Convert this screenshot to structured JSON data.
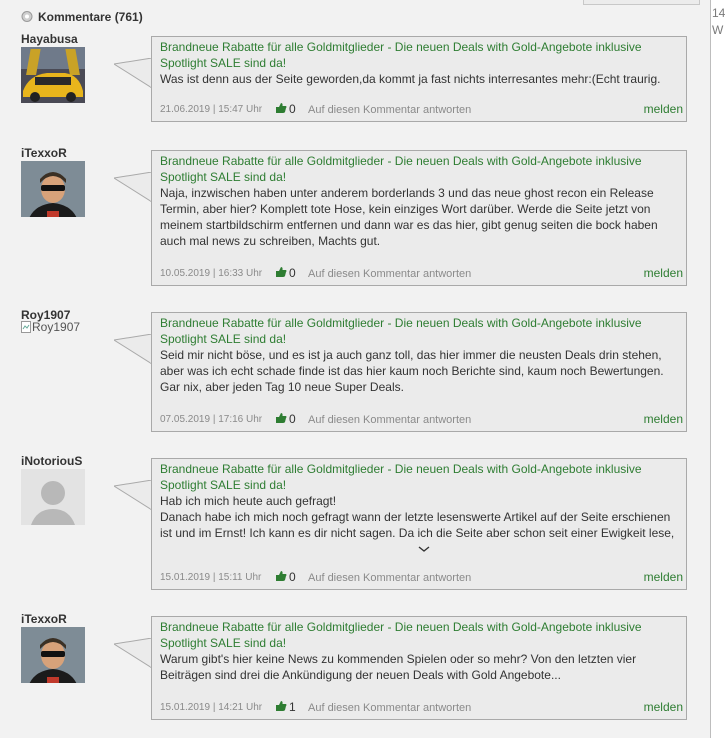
{
  "header": {
    "label": "Kommentare (761)"
  },
  "side_text": [
    "14",
    "W"
  ],
  "article_title": "Brandneue Rabatte für alle Goldmitglieder - Die neuen Deals with Gold-Angebote inklusive Spotlight SALE sind da!",
  "reply_label": "Auf diesen Kommentar antworten",
  "report_label": "melden",
  "comments": [
    {
      "author": "Hayabusa",
      "text": "Was ist denn aus der Seite geworden,da kommt ja fast nichts interresantes mehr:(Echt traurig.",
      "date": "21.06.2019 | 15:47 Uhr",
      "likes": "0"
    },
    {
      "author": "iTexxoR",
      "text": "Naja, inzwischen haben unter anderem borderlands 3 und das neue ghost recon ein Release Termin, aber hier? Komplett tote Hose, kein einziges Wort darüber. Werde die Seite jetzt von meinem startbildschirm entfernen und dann war es das hier, gibt genug seiten die bock haben auch mal news zu schreiben, Machts gut.",
      "date": "10.05.2019 | 16:33 Uhr",
      "likes": "0"
    },
    {
      "author": "Roy1907",
      "avatar_alt": "Roy1907",
      "text": "Seid mir nicht böse, und es ist ja auch ganz toll, das hier immer die neusten Deals drin stehen, aber was ich echt schade finde ist das hier kaum noch Berichte sind, kaum noch Bewertungen. Gar nix, aber jeden Tag 10 neue Super Deals.",
      "date": "07.05.2019 | 17:16 Uhr",
      "likes": "0"
    },
    {
      "author": "iNotoriouS",
      "text": "Hab ich mich heute auch gefragt!\nDanach habe ich mich noch gefragt wann der letzte lesenswerte Artikel auf der Seite erschienen ist und im Ernst! Ich kann es dir nicht sagen. Da ich die Seite aber schon seit einer Ewigkeit lese,",
      "date": "15.01.2019 | 15:11 Uhr",
      "likes": "0"
    },
    {
      "author": "iTexxoR",
      "text": "Warum gibt's hier keine News zu kommenden Spielen oder so mehr? Von den letzten vier Beiträgen sind drei die Ankündigung der neuen Deals with Gold Angebote...",
      "date": "15.01.2019 | 14:21 Uhr",
      "likes": "1"
    }
  ]
}
